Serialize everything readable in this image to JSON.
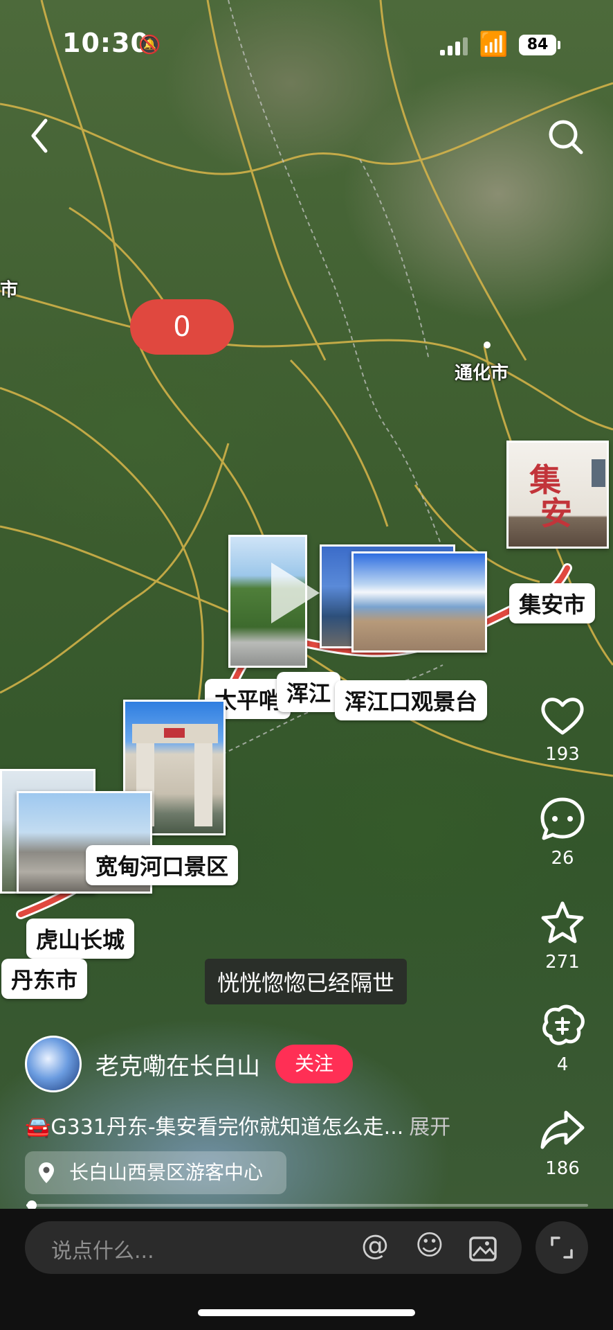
{
  "status_bar": {
    "time": "10:30",
    "battery": "84"
  },
  "nav": {
    "back_icon": "chevron-left-icon",
    "search_icon": "search-icon"
  },
  "map": {
    "counter": "0",
    "place_labels": [
      "通化市",
      "市"
    ],
    "spot_labels": {
      "jian": "集安市",
      "taiping": "太平哨",
      "hunjiang": "浑江",
      "hunjiangkou": "浑江口观景台",
      "kuandian": "宽甸河口景区",
      "hushan": "虎山长城",
      "dandong": "丹东市"
    }
  },
  "subtitle": "恍恍惚惚已经隔世",
  "actions": {
    "like": {
      "icon": "heart-icon",
      "count": "193"
    },
    "comment": {
      "icon": "comment-icon",
      "count": "26"
    },
    "favorite": {
      "icon": "star-icon",
      "count": "271"
    },
    "share_wechat": {
      "icon": "reward-icon",
      "count": "4"
    },
    "share": {
      "icon": "share-icon",
      "count": "186"
    }
  },
  "author": {
    "name": "老克嘞在长白山",
    "follow_label": "关注"
  },
  "description": {
    "text": "🚘G331丹东-集安看完你就知道怎么走...",
    "more": "展开"
  },
  "location": {
    "text": "长白山西景区游客中心"
  },
  "progress": {
    "fraction": 0.01
  },
  "comment_bar": {
    "placeholder": "说点什么..."
  },
  "colors": {
    "accent_red": "#ff2f55",
    "route_red": "#e0483f"
  }
}
